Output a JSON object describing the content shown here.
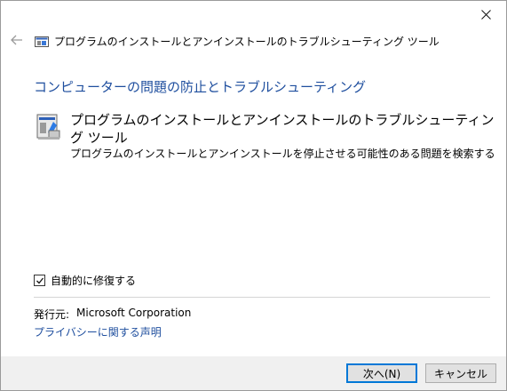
{
  "window": {
    "title": "プログラムのインストールとアンインストールのトラブルシューティング ツール",
    "back_icon": "back-arrow-icon",
    "close_icon": "close-icon"
  },
  "main": {
    "heading": "コンピューターの問題の防止とトラブルシューティング",
    "tool": {
      "title": "プログラムのインストールとアンインストールのトラブルシューティング ツール",
      "description": "プログラムのインストールとアンインストールを停止させる可能性のある問題を検索する",
      "icon": "troubleshooter-icon"
    },
    "auto_fix": {
      "label": "自動的に修復する",
      "checked": true
    },
    "publisher": {
      "label": "発行元:",
      "value": "Microsoft Corporation"
    },
    "privacy_link": "プライバシーに関する声明"
  },
  "footer": {
    "next_label": "次へ(N)",
    "cancel_label": "キャンセル"
  },
  "colors": {
    "accent": "#1e4e9e",
    "focus": "#0078d7"
  }
}
